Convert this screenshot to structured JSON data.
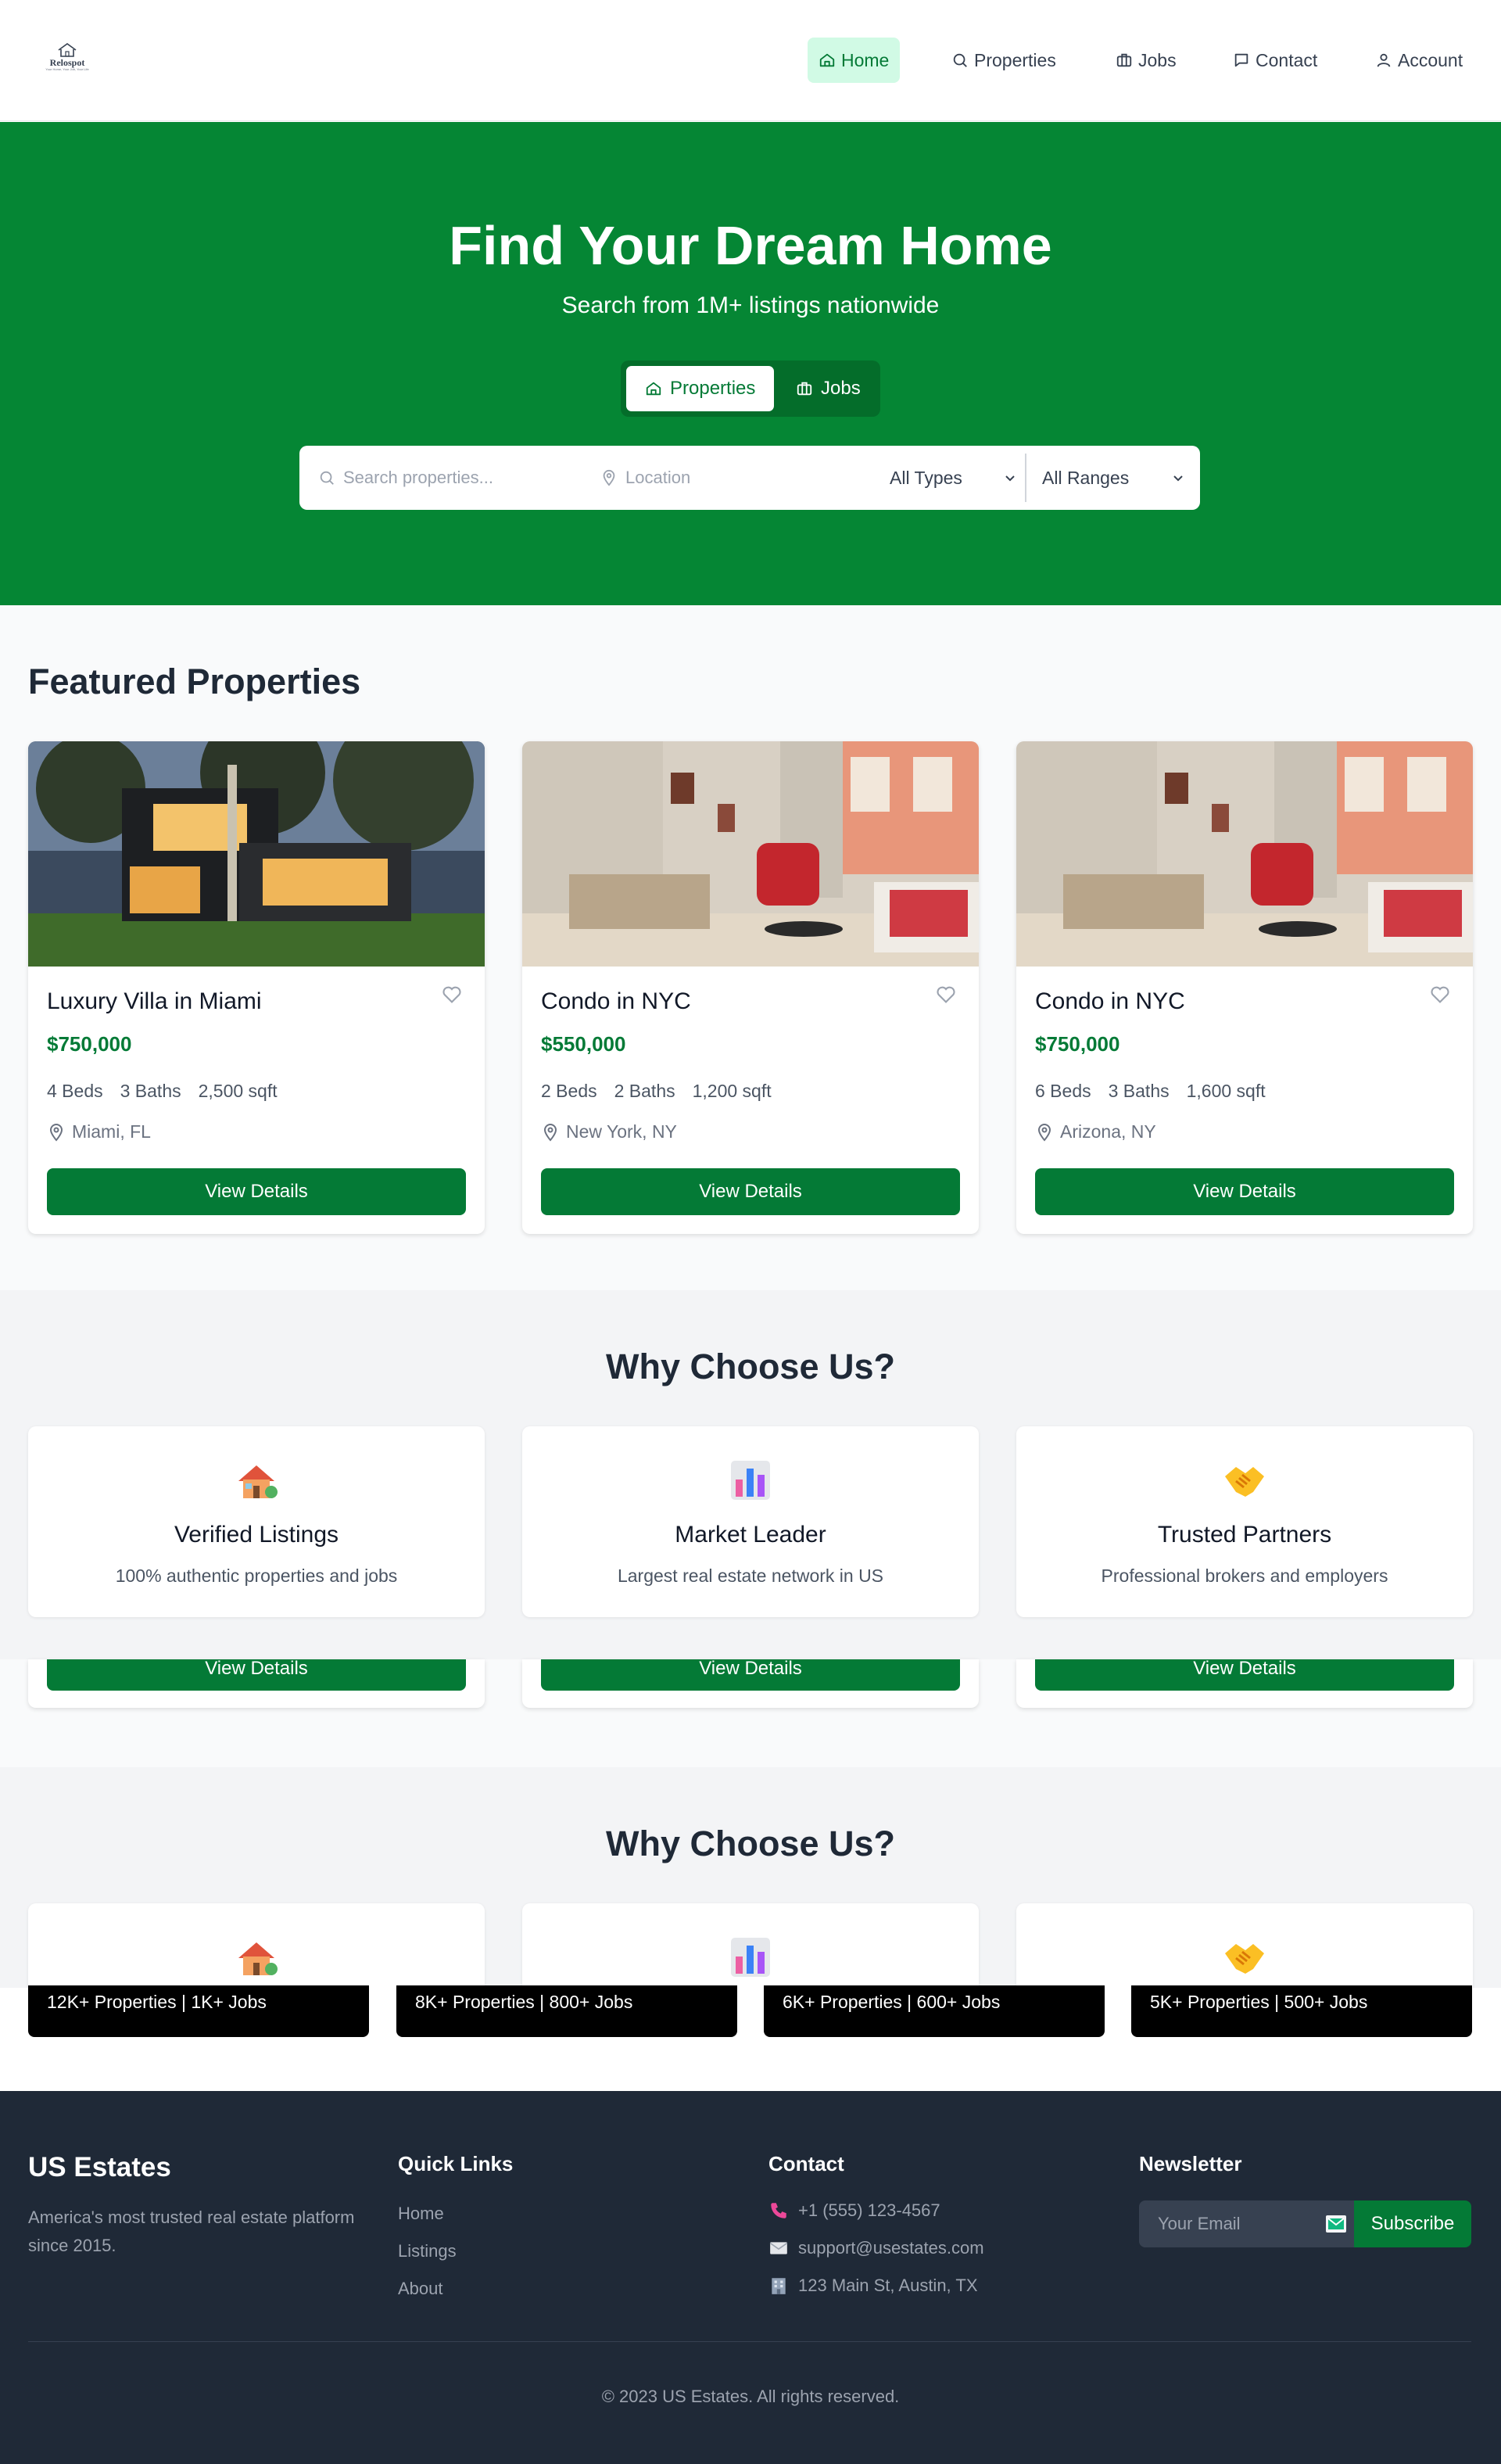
{
  "brand": {
    "logo_text": "Relospot",
    "logo_tagline": "Your Home, Your Job, Your Life"
  },
  "nav": [
    {
      "label": "Home",
      "icon": "home-icon",
      "active": true
    },
    {
      "label": "Properties",
      "icon": "search-icon",
      "active": false
    },
    {
      "label": "Jobs",
      "icon": "briefcase-icon",
      "active": false
    },
    {
      "label": "Contact",
      "icon": "chat-icon",
      "active": false
    },
    {
      "label": "Account",
      "icon": "user-icon",
      "active": false
    }
  ],
  "hero": {
    "title": "Find Your Dream Home",
    "subtitle": "Search from 1M+ listings nationwide",
    "toggle": {
      "properties": "Properties",
      "jobs": "Jobs",
      "selected": "Properties"
    },
    "search": {
      "query_placeholder": "Search properties...",
      "location_placeholder": "Location",
      "type_value": "All Types",
      "range_value": "All Ranges"
    }
  },
  "featured": {
    "title": "Featured Properties",
    "cards": [
      {
        "title": "Luxury Villa in Miami",
        "price": "$750,000",
        "beds": "4 Beds",
        "baths": "3 Baths",
        "sqft": "2,500 sqft",
        "location": "Miami, FL",
        "button": "View Details",
        "image": "modern-house-photo"
      },
      {
        "title": "Condo in NYC",
        "price": "$550,000",
        "beds": "2 Beds",
        "baths": "2 Baths",
        "sqft": "1,200 sqft",
        "location": "New York, NY",
        "button": "View Details",
        "image": "living-room-photo"
      },
      {
        "title": "Condo in NYC",
        "price": "$750,000",
        "beds": "6 Beds",
        "baths": "3 Baths",
        "sqft": "1,600 sqft",
        "location": "Arizona, NY",
        "button": "View Details",
        "image": "living-room-photo"
      }
    ]
  },
  "why": {
    "title": "Why Choose Us?",
    "features": [
      {
        "icon": "house-icon",
        "title": "Verified Listings",
        "desc": "100% authentic properties and jobs"
      },
      {
        "icon": "bar-chart-icon",
        "title": "Market Leader",
        "desc": "Largest real estate network in US"
      },
      {
        "icon": "handshake-icon",
        "title": "Trusted Partners",
        "desc": "Professional brokers and employers"
      }
    ]
  },
  "ghost": {
    "button": "View Details"
  },
  "stats": [
    "12K+ Properties | 1K+ Jobs",
    "8K+ Properties | 800+ Jobs",
    "6K+ Properties | 600+ Jobs",
    "5K+ Properties | 500+ Jobs"
  ],
  "footer": {
    "brand": "US Estates",
    "desc": "America's most trusted real estate platform since 2015.",
    "quick_links_title": "Quick Links",
    "links": [
      "Home",
      "Listings",
      "About"
    ],
    "contact_title": "Contact",
    "phone": "+1 (555) 123-4567",
    "email": "support@usestates.com",
    "address": "123 Main St, Austin, TX",
    "newsletter_title": "Newsletter",
    "newsletter_placeholder": "Your Email",
    "subscribe": "Subscribe",
    "copyright": "© 2023 US Estates. All rights reserved."
  },
  "colors": {
    "primary": "#058634",
    "primary_dark": "#047a36",
    "footer_bg": "#1f2937",
    "section_bg": "#f3f4f6"
  }
}
